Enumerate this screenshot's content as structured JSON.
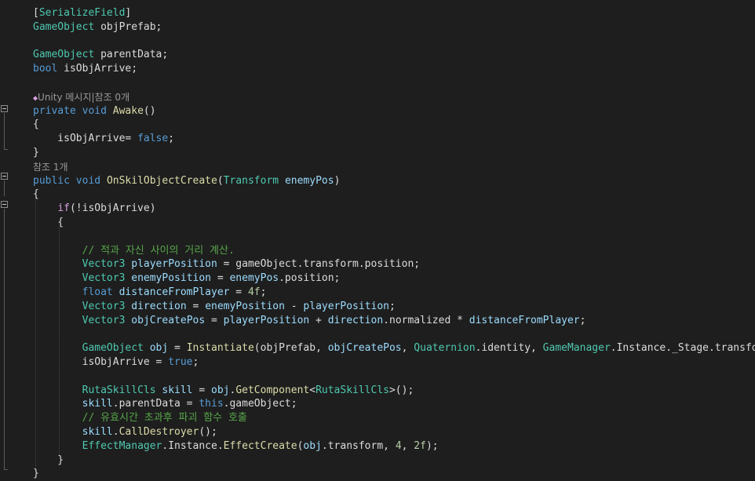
{
  "code_lines": [
    [
      {
        "t": "[",
        "c": "plain"
      },
      {
        "t": "SerializeField",
        "c": "type"
      },
      {
        "t": "]",
        "c": "plain"
      }
    ],
    [
      {
        "t": "GameObject",
        "c": "type"
      },
      {
        "t": " objPrefab;",
        "c": "plain"
      }
    ],
    [],
    [
      {
        "t": "GameObject",
        "c": "type"
      },
      {
        "t": " parentData;",
        "c": "plain"
      }
    ],
    [
      {
        "t": "bool",
        "c": "kw"
      },
      {
        "t": " isObjArrive;",
        "c": "plain"
      }
    ],
    [],
    [
      {
        "t": "Unity 메시지|참조 0개",
        "c": "lens"
      }
    ],
    [
      {
        "t": "private",
        "c": "kw"
      },
      {
        "t": " ",
        "c": "plain"
      },
      {
        "t": "void",
        "c": "kw"
      },
      {
        "t": " ",
        "c": "plain"
      },
      {
        "t": "Awake",
        "c": "method"
      },
      {
        "t": "()",
        "c": "plain"
      }
    ],
    [
      {
        "t": "{",
        "c": "plain"
      }
    ],
    [
      {
        "t": "    isObjArrive= ",
        "c": "plain"
      },
      {
        "t": "false",
        "c": "kw"
      },
      {
        "t": ";",
        "c": "plain"
      }
    ],
    [
      {
        "t": "}",
        "c": "plain"
      }
    ],
    [
      {
        "t": "참조 1개",
        "c": "lens"
      }
    ],
    [
      {
        "t": "public",
        "c": "kw"
      },
      {
        "t": " ",
        "c": "plain"
      },
      {
        "t": "void",
        "c": "kw"
      },
      {
        "t": " ",
        "c": "plain"
      },
      {
        "t": "OnSkilObjectCreate",
        "c": "method"
      },
      {
        "t": "(",
        "c": "plain"
      },
      {
        "t": "Transform",
        "c": "type"
      },
      {
        "t": " ",
        "c": "plain"
      },
      {
        "t": "enemyPos",
        "c": "var"
      },
      {
        "t": ")",
        "c": "plain"
      }
    ],
    [
      {
        "t": "{",
        "c": "plain"
      }
    ],
    [
      {
        "t": "    ",
        "c": "plain"
      },
      {
        "t": "if",
        "c": "kw2"
      },
      {
        "t": "(!isObjArrive)",
        "c": "plain"
      }
    ],
    [
      {
        "t": "    {",
        "c": "plain"
      }
    ],
    [],
    [
      {
        "t": "        ",
        "c": "plain"
      },
      {
        "t": "// 적과 자신 사이의 거리 계산.",
        "c": "cmt"
      }
    ],
    [
      {
        "t": "        ",
        "c": "plain"
      },
      {
        "t": "Vector3",
        "c": "type"
      },
      {
        "t": " ",
        "c": "plain"
      },
      {
        "t": "playerPosition",
        "c": "var"
      },
      {
        "t": " = gameObject.transform.position;",
        "c": "plain"
      }
    ],
    [
      {
        "t": "        ",
        "c": "plain"
      },
      {
        "t": "Vector3",
        "c": "type"
      },
      {
        "t": " ",
        "c": "plain"
      },
      {
        "t": "enemyPosition",
        "c": "var"
      },
      {
        "t": " = ",
        "c": "plain"
      },
      {
        "t": "enemyPos",
        "c": "var"
      },
      {
        "t": ".position;",
        "c": "plain"
      }
    ],
    [
      {
        "t": "        ",
        "c": "plain"
      },
      {
        "t": "float",
        "c": "kw"
      },
      {
        "t": " ",
        "c": "plain"
      },
      {
        "t": "distanceFromPlayer",
        "c": "var"
      },
      {
        "t": " = ",
        "c": "plain"
      },
      {
        "t": "4f",
        "c": "num"
      },
      {
        "t": ";",
        "c": "plain"
      }
    ],
    [
      {
        "t": "        ",
        "c": "plain"
      },
      {
        "t": "Vector3",
        "c": "type"
      },
      {
        "t": " ",
        "c": "plain"
      },
      {
        "t": "direction",
        "c": "var"
      },
      {
        "t": " = ",
        "c": "plain"
      },
      {
        "t": "enemyPosition",
        "c": "var"
      },
      {
        "t": " - ",
        "c": "plain"
      },
      {
        "t": "playerPosition",
        "c": "var"
      },
      {
        "t": ";",
        "c": "plain"
      }
    ],
    [
      {
        "t": "        ",
        "c": "plain"
      },
      {
        "t": "Vector3",
        "c": "type"
      },
      {
        "t": " ",
        "c": "plain"
      },
      {
        "t": "objCreatePos",
        "c": "var"
      },
      {
        "t": " = ",
        "c": "plain"
      },
      {
        "t": "playerPosition",
        "c": "var"
      },
      {
        "t": " + ",
        "c": "plain"
      },
      {
        "t": "direction",
        "c": "var"
      },
      {
        "t": ".normalized * ",
        "c": "plain"
      },
      {
        "t": "distanceFromPlayer",
        "c": "var"
      },
      {
        "t": ";",
        "c": "plain"
      }
    ],
    [],
    [
      {
        "t": "        ",
        "c": "plain"
      },
      {
        "t": "GameObject",
        "c": "type"
      },
      {
        "t": " ",
        "c": "plain"
      },
      {
        "t": "obj",
        "c": "var"
      },
      {
        "t": " = ",
        "c": "plain"
      },
      {
        "t": "Instantiate",
        "c": "method"
      },
      {
        "t": "(objPrefab, ",
        "c": "plain"
      },
      {
        "t": "objCreatePos",
        "c": "var"
      },
      {
        "t": ", ",
        "c": "plain"
      },
      {
        "t": "Quaternion",
        "c": "type"
      },
      {
        "t": ".identity, ",
        "c": "plain"
      },
      {
        "t": "GameManager",
        "c": "type"
      },
      {
        "t": ".Instance._Stage.transform);",
        "c": "plain"
      }
    ],
    [
      {
        "t": "        isObjArrive = ",
        "c": "plain"
      },
      {
        "t": "true",
        "c": "kw"
      },
      {
        "t": ";",
        "c": "plain"
      }
    ],
    [],
    [
      {
        "t": "        ",
        "c": "plain"
      },
      {
        "t": "RutaSkillCls",
        "c": "type"
      },
      {
        "t": " ",
        "c": "plain"
      },
      {
        "t": "skill",
        "c": "var"
      },
      {
        "t": " = ",
        "c": "plain"
      },
      {
        "t": "obj",
        "c": "var"
      },
      {
        "t": ".",
        "c": "plain"
      },
      {
        "t": "GetComponent",
        "c": "method"
      },
      {
        "t": "<",
        "c": "plain"
      },
      {
        "t": "RutaSkillCls",
        "c": "type"
      },
      {
        "t": ">();",
        "c": "plain"
      }
    ],
    [
      {
        "t": "        ",
        "c": "plain"
      },
      {
        "t": "skill",
        "c": "var"
      },
      {
        "t": ".parentData = ",
        "c": "plain"
      },
      {
        "t": "this",
        "c": "kw"
      },
      {
        "t": ".gameObject;",
        "c": "plain"
      }
    ],
    [
      {
        "t": "        ",
        "c": "plain"
      },
      {
        "t": "// 유효시간 초과후 파괴 함수 호출",
        "c": "cmt"
      }
    ],
    [
      {
        "t": "        ",
        "c": "plain"
      },
      {
        "t": "skill",
        "c": "var"
      },
      {
        "t": ".",
        "c": "plain"
      },
      {
        "t": "CallDestroyer",
        "c": "method"
      },
      {
        "t": "();",
        "c": "plain"
      }
    ],
    [
      {
        "t": "        ",
        "c": "plain"
      },
      {
        "t": "EffectManager",
        "c": "type"
      },
      {
        "t": ".Instance.",
        "c": "plain"
      },
      {
        "t": "EffectCreate",
        "c": "method"
      },
      {
        "t": "(",
        "c": "plain"
      },
      {
        "t": "obj",
        "c": "var"
      },
      {
        "t": ".transform, ",
        "c": "plain"
      },
      {
        "t": "4",
        "c": "num"
      },
      {
        "t": ", ",
        "c": "plain"
      },
      {
        "t": "2f",
        "c": "num"
      },
      {
        "t": ");",
        "c": "plain"
      }
    ],
    [
      {
        "t": "    }",
        "c": "plain"
      }
    ],
    [
      {
        "t": "}",
        "c": "plain"
      }
    ]
  ]
}
